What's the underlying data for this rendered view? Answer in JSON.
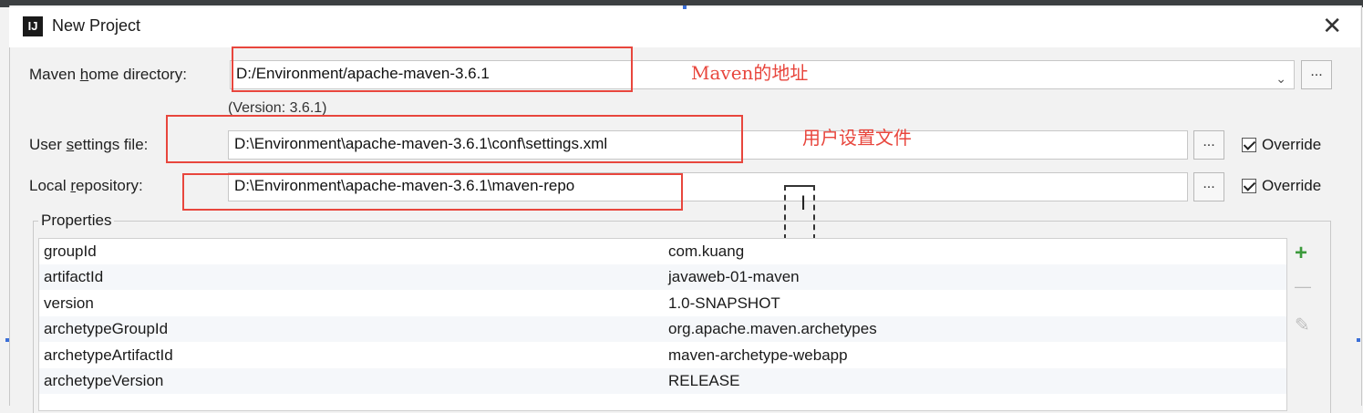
{
  "window": {
    "title": "New Project",
    "icon": "IJ",
    "close_label": "✕"
  },
  "maven_home": {
    "label_pre": "Maven ",
    "label_mn": "h",
    "label_post": "ome directory:",
    "value": "D:/Environment/apache-maven-3.6.1",
    "version": "(Version: 3.6.1)",
    "browse_label": "..."
  },
  "user_settings": {
    "label_pre": "User ",
    "label_mn": "s",
    "label_post": "ettings file:",
    "value": "D:\\Environment\\apache-maven-3.6.1\\conf\\settings.xml",
    "browse_label": "...",
    "override_label": "Override",
    "override_checked": true
  },
  "local_repo": {
    "label_pre": "Local ",
    "label_mn": "r",
    "label_post": "epository:",
    "value": "D:\\Environment\\apache-maven-3.6.1\\maven-repo",
    "browse_label": "...",
    "override_label": "Override",
    "override_checked": true
  },
  "annotations": {
    "maven_address": "Maven的地址",
    "user_settings_file": "用户设置文件",
    "color": "#e8463d"
  },
  "properties": {
    "title": "Properties",
    "rows": [
      {
        "key": "groupId",
        "value": "com.kuang"
      },
      {
        "key": "artifactId",
        "value": "javaweb-01-maven"
      },
      {
        "key": "version",
        "value": "1.0-SNAPSHOT"
      },
      {
        "key": "archetypeGroupId",
        "value": "org.apache.maven.archetypes"
      },
      {
        "key": "archetypeArtifactId",
        "value": "maven-archetype-webapp"
      },
      {
        "key": "archetypeVersion",
        "value": "RELEASE"
      }
    ],
    "add_icon": "+",
    "remove_icon": "—",
    "edit_icon": "✎"
  },
  "colors": {
    "add": "#3c9a3c",
    "disabled": "#bdbdbd",
    "row_alt": "#f5f7fa"
  }
}
